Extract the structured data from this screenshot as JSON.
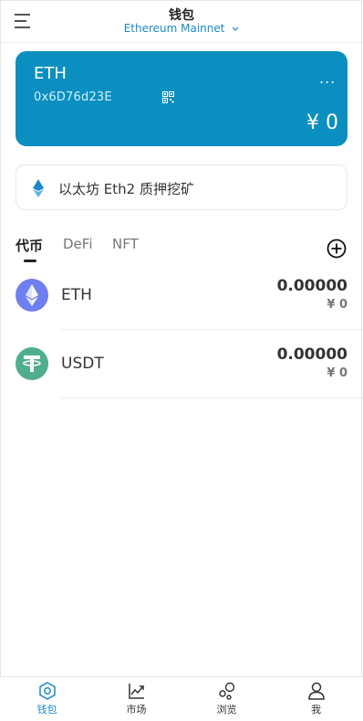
{
  "header": {
    "title": "钱包",
    "network": "Ethereum Mainnet"
  },
  "wallet_card": {
    "name": "ETH",
    "address": "0x6D76d23E",
    "more": "...",
    "balance": "¥ 0",
    "color": "#0a8fc0"
  },
  "promo": {
    "text": "以太坊 Eth2 质押挖矿"
  },
  "tabs": [
    {
      "label": "代币"
    },
    {
      "label": "DeFi"
    },
    {
      "label": "NFT"
    }
  ],
  "tokens": [
    {
      "symbol": "ETH",
      "amount": "0.00000",
      "fiat": "¥ 0",
      "icon": "ethereum-icon"
    },
    {
      "symbol": "USDT",
      "amount": "0.00000",
      "fiat": "¥ 0",
      "icon": "tether-icon"
    }
  ],
  "bottom_nav": [
    {
      "label": "钱包",
      "icon": "wallet-icon"
    },
    {
      "label": "市场",
      "icon": "market-chart-icon"
    },
    {
      "label": "浏览",
      "icon": "browse-icon"
    },
    {
      "label": "我",
      "icon": "profile-icon"
    }
  ],
  "colors": {
    "accent": "#1e88c8",
    "card": "#0a8fc0",
    "usdt": "#4fae8f",
    "eth": "#6e7ff0"
  }
}
